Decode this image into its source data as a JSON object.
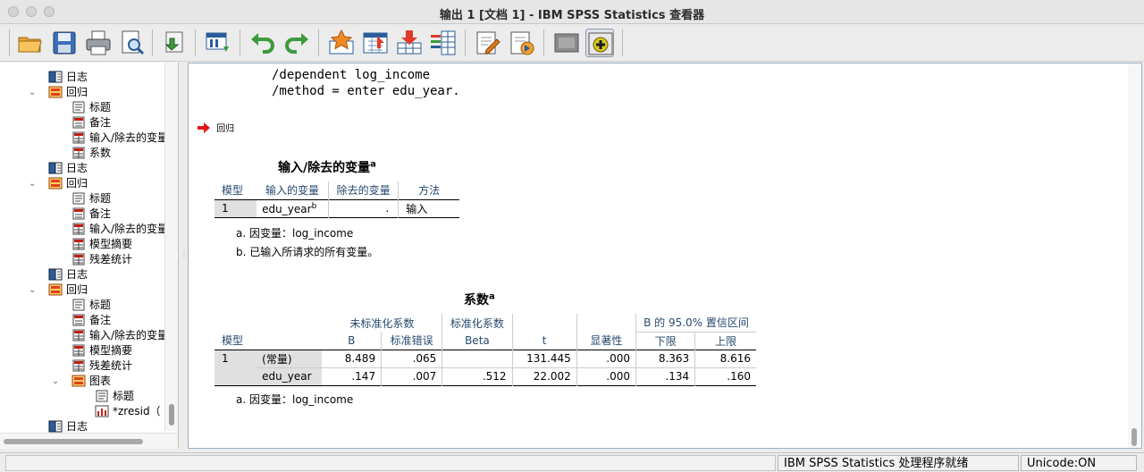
{
  "window": {
    "title": "输出 1 [文档 1] - IBM SPSS Statistics 查看器"
  },
  "toolbar": {
    "icons": [
      "open-icon",
      "save-icon",
      "print-icon",
      "print-preview-icon",
      "export-icon",
      "goto-data-icon",
      "undo-icon",
      "redo-icon",
      "goto-case-icon",
      "goto-variable-icon",
      "insert-cases-icon",
      "variables-icon",
      "insert-heading-icon",
      "insert-title-icon",
      "hide-icon",
      "designate-window-icon"
    ]
  },
  "tree": {
    "items": [
      {
        "label": "日志",
        "icon": "log-icon",
        "level": 2
      },
      {
        "label": "回归",
        "icon": "procedure-icon",
        "level": 1,
        "expanded": true
      },
      {
        "label": "标题",
        "icon": "title-icon",
        "level": 3
      },
      {
        "label": "备注",
        "icon": "notes-icon",
        "level": 3
      },
      {
        "label": "输入/除去的变量",
        "icon": "table-icon",
        "level": 3
      },
      {
        "label": "系数",
        "icon": "table-icon",
        "level": 3
      },
      {
        "label": "日志",
        "icon": "log-icon",
        "level": 2
      },
      {
        "label": "回归",
        "icon": "procedure-icon",
        "level": 1,
        "expanded": true
      },
      {
        "label": "标题",
        "icon": "title-icon",
        "level": 3
      },
      {
        "label": "备注",
        "icon": "notes-icon",
        "level": 3
      },
      {
        "label": "输入/除去的变量",
        "icon": "table-icon",
        "level": 3
      },
      {
        "label": "模型摘要",
        "icon": "table-icon",
        "level": 3
      },
      {
        "label": "残差统计",
        "icon": "table-icon",
        "level": 3
      },
      {
        "label": "日志",
        "icon": "log-icon",
        "level": 2
      },
      {
        "label": "回归",
        "icon": "procedure-icon",
        "level": 1,
        "expanded": true
      },
      {
        "label": "标题",
        "icon": "title-icon",
        "level": 3
      },
      {
        "label": "备注",
        "icon": "notes-icon",
        "level": 3
      },
      {
        "label": "输入/除去的变量",
        "icon": "table-icon",
        "level": 3
      },
      {
        "label": "模型摘要",
        "icon": "table-icon",
        "level": 3
      },
      {
        "label": "残差统计",
        "icon": "table-icon",
        "level": 3
      },
      {
        "label": "图表",
        "icon": "procedure-icon",
        "level": 3,
        "expanded": true
      },
      {
        "label": "标题",
        "icon": "title-icon",
        "level": 4
      },
      {
        "label": "*zresid（",
        "icon": "chart-icon",
        "level": 4
      },
      {
        "label": "日志",
        "icon": "log-icon",
        "level": 2
      }
    ]
  },
  "output": {
    "syntax_lines": [
      "/dependent log_income",
      "/method = enter edu_year."
    ],
    "section_label": "回归",
    "entered_removed": {
      "title": "输入/除去的变量",
      "title_sup": "a",
      "headers": [
        "模型",
        "输入的变量",
        "除去的变量",
        "方法"
      ],
      "rows": [
        [
          "1",
          "edu_year",
          ".",
          "输入"
        ]
      ],
      "entered_sup": "b",
      "notes": [
        "a. 因变量：log_income",
        "b. 已输入所请求的所有变量。"
      ]
    },
    "coefficients": {
      "title": "系数",
      "title_sup": "a",
      "group_headers": [
        "未标准化系数",
        "标准化系数",
        "B 的 95.0% 置信区间"
      ],
      "headers": [
        "模型",
        "B",
        "标准错误",
        "Beta",
        "t",
        "显著性",
        "下限",
        "上限"
      ],
      "model": "1",
      "rows": [
        [
          "(常量)",
          "8.489",
          ".065",
          "",
          "131.445",
          ".000",
          "8.363",
          "8.616"
        ],
        [
          "edu_year",
          ".147",
          ".007",
          ".512",
          "22.002",
          ".000",
          ".134",
          ".160"
        ]
      ],
      "notes": [
        "a. 因变量：log_income"
      ]
    }
  },
  "status": {
    "processor": "IBM SPSS Statistics 处理程序就绪",
    "unicode": "Unicode:ON"
  }
}
